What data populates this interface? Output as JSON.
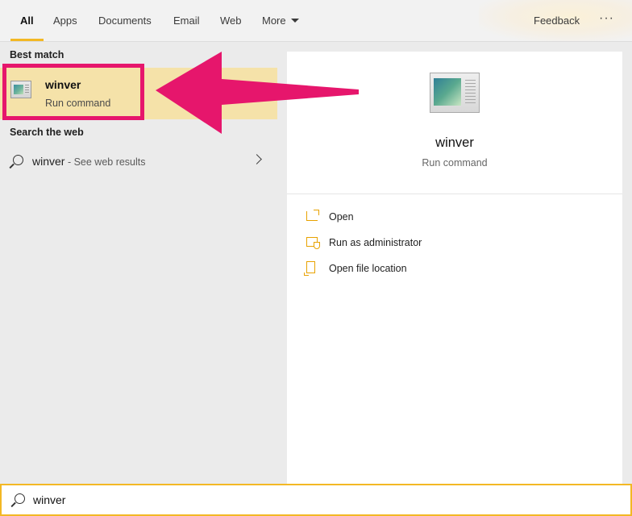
{
  "tabs": [
    {
      "label": "All",
      "active": true
    },
    {
      "label": "Apps"
    },
    {
      "label": "Documents"
    },
    {
      "label": "Email"
    },
    {
      "label": "Web"
    },
    {
      "label": "More"
    }
  ],
  "header": {
    "feedback": "Feedback",
    "more_options": "···"
  },
  "left": {
    "best_match_label": "Best match",
    "best_match": {
      "title": "winver",
      "subtitle": "Run command",
      "icon": "app-window-icon"
    },
    "search_web_label": "Search the web",
    "web_result": {
      "term": "winver",
      "suffix": " - See web results",
      "icon": "search-icon"
    }
  },
  "detail": {
    "title": "winver",
    "subtitle": "Run command",
    "actions": [
      {
        "label": "Open",
        "icon": "open-icon"
      },
      {
        "label": "Run as administrator",
        "icon": "admin-shield-icon"
      },
      {
        "label": "Open file location",
        "icon": "folder-icon"
      }
    ]
  },
  "search": {
    "value": "winver"
  },
  "colors": {
    "accent": "#f3b824",
    "highlight": "#f5e2a9",
    "annotation": "#e6166c"
  }
}
